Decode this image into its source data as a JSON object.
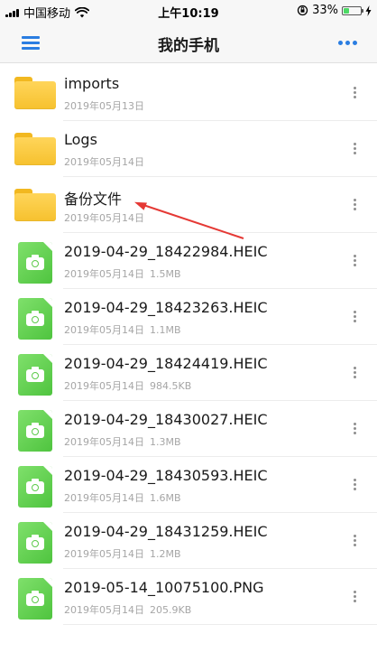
{
  "status_bar": {
    "carrier": "中国移动",
    "time": "上午10:19",
    "battery_percent": "33%",
    "battery_level": 0.33,
    "battery_color": "#4cd964"
  },
  "header": {
    "title": "我的手机",
    "accent_color": "#2a7de1"
  },
  "files": [
    {
      "type": "folder",
      "name": "imports",
      "date": "2019年05月13日",
      "size": ""
    },
    {
      "type": "folder",
      "name": "Logs",
      "date": "2019年05月14日",
      "size": ""
    },
    {
      "type": "folder",
      "name": "备份文件",
      "date": "2019年05月14日",
      "size": ""
    },
    {
      "type": "image",
      "name": "2019-04-29_18422984.HEIC",
      "date": "2019年05月14日",
      "size": "1.5MB"
    },
    {
      "type": "image",
      "name": "2019-04-29_18423263.HEIC",
      "date": "2019年05月14日",
      "size": "1.1MB"
    },
    {
      "type": "image",
      "name": "2019-04-29_18424419.HEIC",
      "date": "2019年05月14日",
      "size": "984.5KB"
    },
    {
      "type": "image",
      "name": "2019-04-29_18430027.HEIC",
      "date": "2019年05月14日",
      "size": "1.3MB"
    },
    {
      "type": "image",
      "name": "2019-04-29_18430593.HEIC",
      "date": "2019年05月14日",
      "size": "1.6MB"
    },
    {
      "type": "image",
      "name": "2019-04-29_18431259.HEIC",
      "date": "2019年05月14日",
      "size": "1.2MB"
    },
    {
      "type": "image",
      "name": "2019-05-14_10075100.PNG",
      "date": "2019年05月14日",
      "size": "205.9KB"
    }
  ],
  "icons": {
    "folder": "folder-icon",
    "image": "image-file-icon",
    "menu": "hamburger-menu-icon",
    "more": "more-horizontal-icon",
    "row_more": "more-vertical-icon"
  },
  "annotation": {
    "color": "#e53935",
    "shape": "arrow"
  }
}
